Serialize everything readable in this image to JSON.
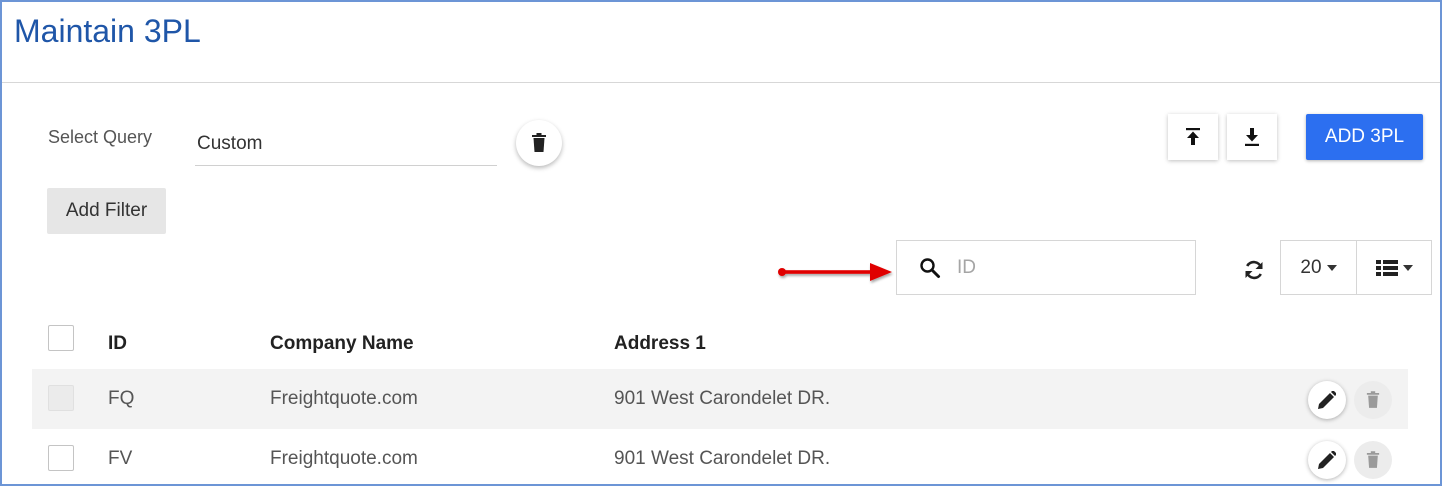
{
  "page": {
    "title": "Maintain 3PL"
  },
  "query": {
    "label": "Select Query",
    "value": "Custom",
    "delete_icon": "trash-icon"
  },
  "toolbar": {
    "export_icon": "upload-icon",
    "import_icon": "download-icon",
    "add_label": "ADD 3PL",
    "add_color": "#2c6ff0"
  },
  "filter": {
    "add_label": "Add Filter"
  },
  "search": {
    "placeholder": "ID",
    "value": "",
    "icon": "search-icon"
  },
  "table_controls": {
    "refresh_icon": "refresh-icon",
    "page_size": "20",
    "columns_icon": "list-columns-icon"
  },
  "table": {
    "columns": [
      "ID",
      "Company Name",
      "Address 1"
    ],
    "rows": [
      {
        "id": "FQ",
        "company": "Freightquote.com",
        "address": "901 West Carondelet DR."
      },
      {
        "id": "FV",
        "company": "Freightquote.com",
        "address": "901 West Carondelet DR."
      }
    ]
  },
  "colors": {
    "title": "#1f56a8",
    "annotation_arrow": "#e00000",
    "frame_border": "#6c95d6"
  }
}
